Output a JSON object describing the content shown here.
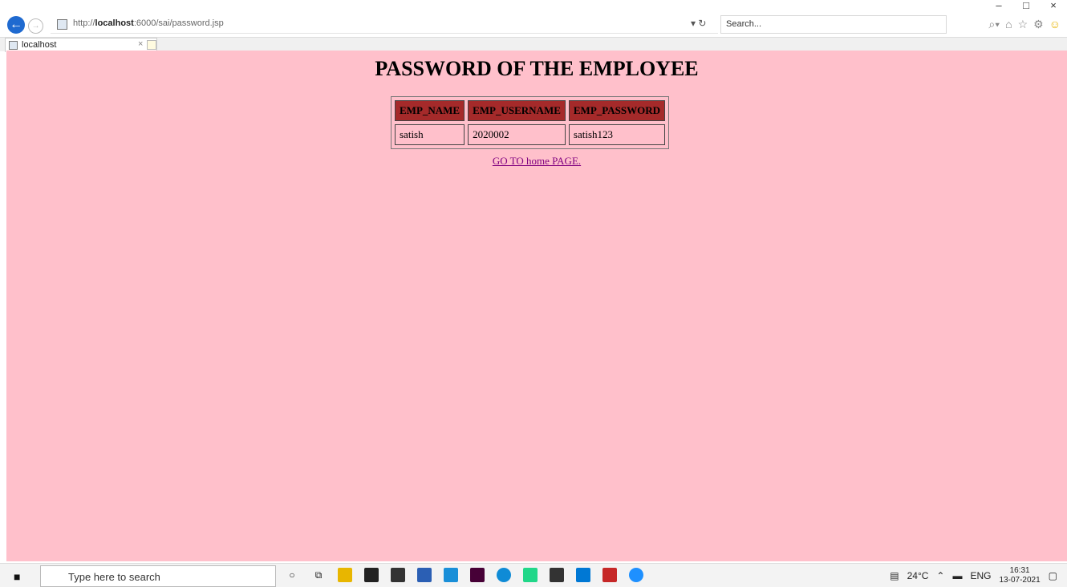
{
  "browser": {
    "url_prefix": "http://",
    "url_host": "localhost",
    "url_rest": ":6000/sai/password.jsp",
    "search_placeholder": "Search...",
    "tab_title": "localhost",
    "tab_close": "×",
    "refresh": "▾ ↻",
    "win_min": "–",
    "win_max": "□",
    "win_close": "×"
  },
  "page": {
    "heading": "PASSWORD OF THE EMPLOYEE",
    "table": {
      "headers": [
        "EMP_NAME",
        "EMP_USERNAME",
        "EMP_PASSWORD"
      ],
      "rows": [
        [
          "satish",
          "2020002",
          "satish123"
        ]
      ]
    },
    "home_link": "GO TO home PAGE.",
    "background_color": "#ffc0cb",
    "header_color": "#a52a2a",
    "link_color": "#800080"
  },
  "taskbar": {
    "search_placeholder": "Type here to search",
    "weather": "24°C",
    "lang": "ENG",
    "time": "16:31",
    "date": "13-07-2021"
  }
}
